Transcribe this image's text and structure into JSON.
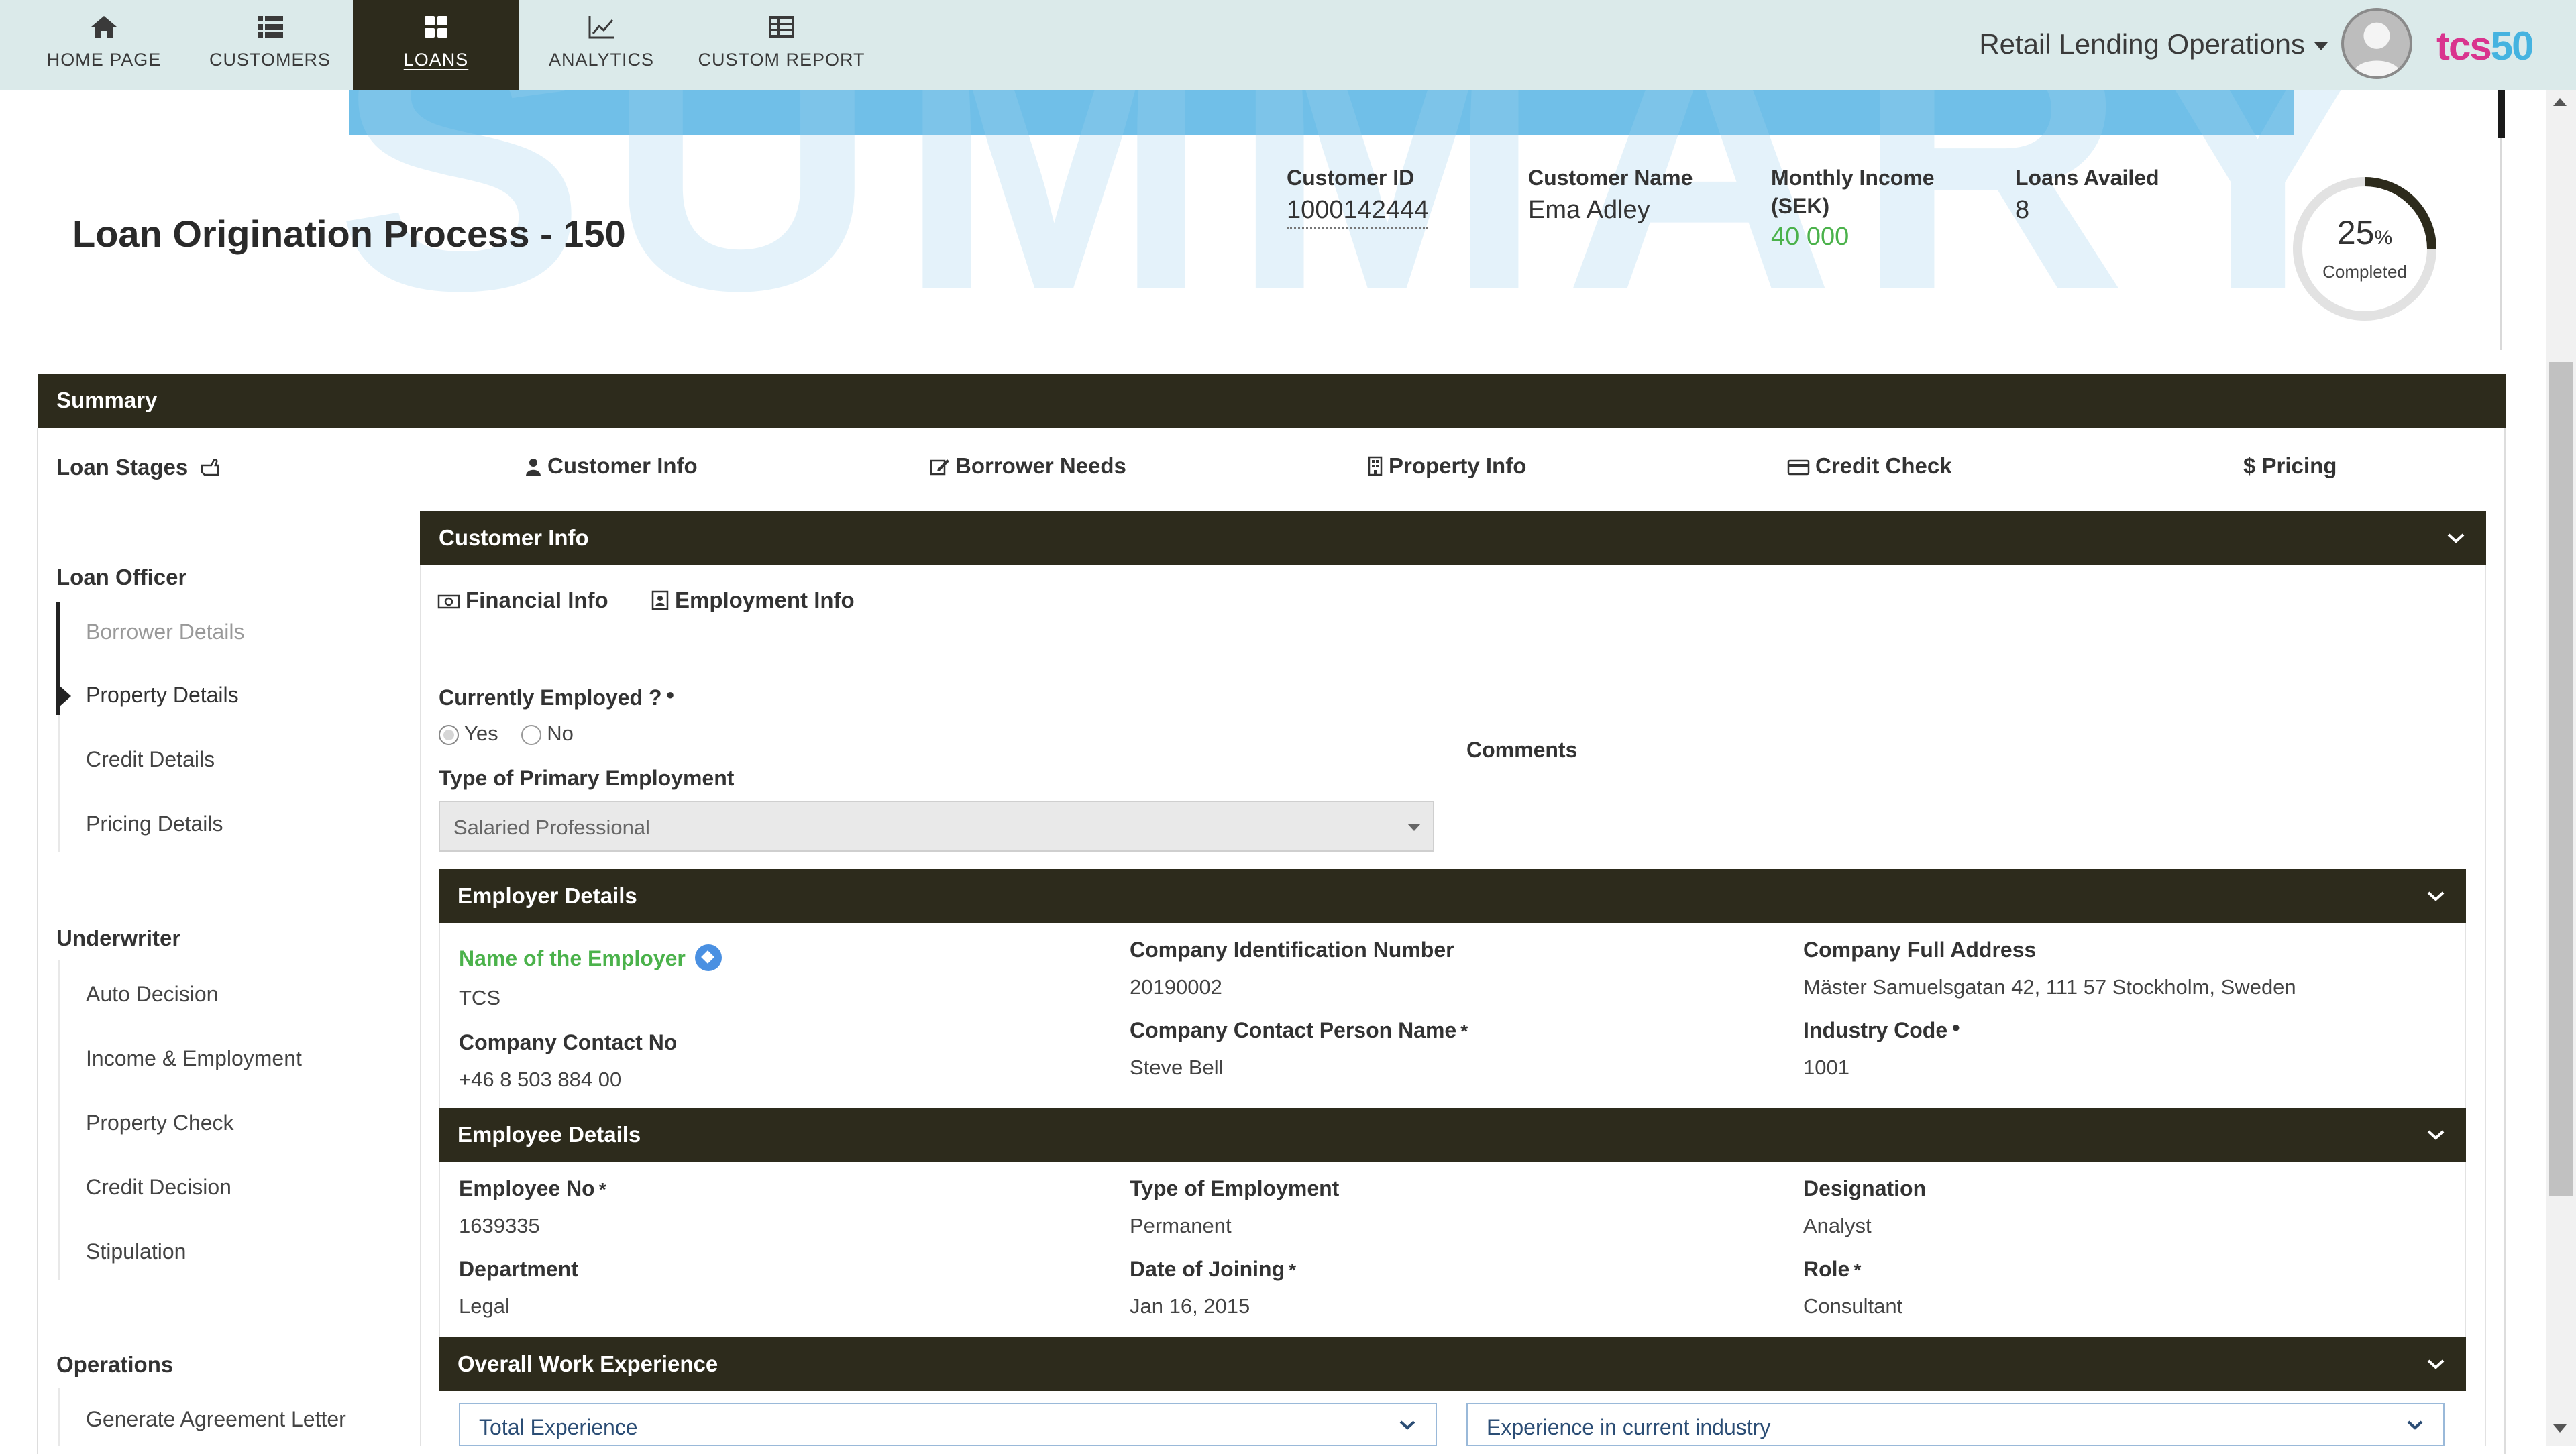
{
  "nav": {
    "items": [
      {
        "label": "HOME PAGE",
        "icon": "home-icon"
      },
      {
        "label": "CUSTOMERS",
        "icon": "list-icon"
      },
      {
        "label": "LOANS",
        "icon": "grid-icon",
        "active": true
      },
      {
        "label": "ANALYTICS",
        "icon": "line-chart-icon"
      },
      {
        "label": "CUSTOM REPORT",
        "icon": "table-icon"
      }
    ],
    "org_selector": "Retail Lending Operations",
    "brand_part1": "tcs",
    "brand_part2": "50"
  },
  "header": {
    "title": "Loan Origination Process - 150",
    "customer_id_label": "Customer ID",
    "customer_id": "1000142444",
    "customer_name_label": "Customer Name",
    "customer_name": "Ema Adley",
    "income_label_1": "Monthly Income",
    "income_label_2": "(SEK)",
    "income_value": "40 000",
    "loans_label": "Loans Availed",
    "loans_value": "8",
    "progress_number": "25",
    "progress_unit": "%",
    "progress_fraction": 0.25,
    "progress_caption": "Completed"
  },
  "summary": {
    "title": "Summary"
  },
  "stages": {
    "label": "Loan Stages",
    "items": [
      "Customer Info",
      "Borrower Needs",
      "Property Info",
      "Credit Check",
      "Pricing"
    ]
  },
  "sidebar": {
    "loan_officer": {
      "title": "Loan Officer",
      "items": [
        "Borrower Details",
        "Property Details",
        "Credit Details",
        "Pricing Details"
      ]
    },
    "underwriter": {
      "title": "Underwriter",
      "items": [
        "Auto Decision",
        "Income & Employment",
        "Property Check",
        "Credit Decision",
        "Stipulation"
      ]
    },
    "operations": {
      "title": "Operations",
      "items": [
        "Generate Agreement Letter"
      ]
    }
  },
  "customer_info": {
    "title": "Customer Info",
    "tabs": [
      "Financial Info",
      "Employment Info"
    ],
    "employed_question": "Currently Employed ?",
    "yes": "Yes",
    "no": "No",
    "primary_type_label": "Type of Primary Employment",
    "primary_type_value": "Salaried Professional",
    "comments_label": "Comments"
  },
  "employer": {
    "title": "Employer Details",
    "name_label": "Name of the Employer",
    "name_value": "TCS",
    "contact_no_label": "Company Contact No",
    "contact_no_value": "+46 8 503 884 00",
    "cin_label": "Company Identification Number",
    "cin_value": "20190002",
    "contact_person_label": "Company Contact Person Name",
    "contact_person_value": "Steve Bell",
    "address_label": "Company Full Address",
    "address_value": "Mäster Samuelsgatan 42, 111 57 Stockholm, Sweden",
    "industry_label": "Industry Code",
    "industry_value": "1001"
  },
  "employee": {
    "title": "Employee Details",
    "emp_no_label": "Employee No",
    "emp_no_value": "1639335",
    "department_label": "Department",
    "department_value": "Legal",
    "type_label": "Type of Employment",
    "type_value": "Permanent",
    "doj_label": "Date of Joining",
    "doj_value": "Jan 16, 2015",
    "designation_label": "Designation",
    "designation_value": "Analyst",
    "role_label": "Role",
    "role_value": "Consultant"
  },
  "experience": {
    "title": "Overall Work Experience",
    "total_label": "Total Experience",
    "industry_label": "Experience in current industry"
  },
  "hero_watermark": "SUMMARY",
  "colors": {
    "nav_bg": "#dbeaea",
    "dark_bar": "#2d2b1c",
    "accent_green": "#4bb24b",
    "accent_blue": "#4a90e2",
    "brand_pink": "#d9348e",
    "brand_blue": "#45b3e0"
  }
}
